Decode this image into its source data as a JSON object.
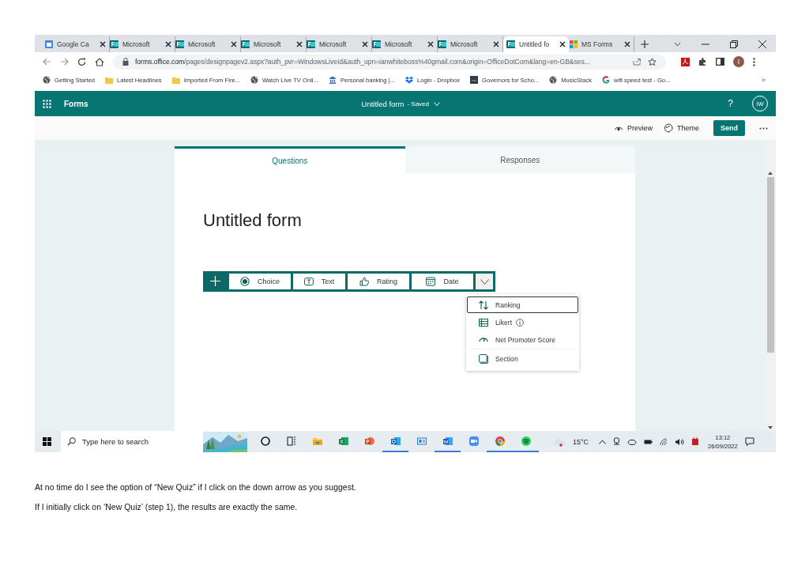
{
  "browser": {
    "tabs": [
      {
        "label": "Google Ca",
        "kind": "calendar",
        "selected": false
      },
      {
        "label": "Microsoft",
        "kind": "forms",
        "selected": false
      },
      {
        "label": "Microsoft",
        "kind": "forms",
        "selected": false
      },
      {
        "label": "Microsoft",
        "kind": "forms",
        "selected": false
      },
      {
        "label": "Microsoft",
        "kind": "forms",
        "selected": false
      },
      {
        "label": "Microsoft",
        "kind": "forms",
        "selected": false
      },
      {
        "label": "Microsoft",
        "kind": "forms",
        "selected": false
      },
      {
        "label": "Untitled fo",
        "kind": "forms",
        "selected": true
      },
      {
        "label": "MS Forms",
        "kind": "windows",
        "selected": false
      }
    ],
    "address_host": "forms.office.com",
    "address_path": "/pages/designpagev2.aspx?auth_pvr=WindowsLiveId&auth_upn=ianwhiteboss%40gmail.com&origin=OfficeDotCom&lang=en-GB&ses...",
    "bookmarks": [
      {
        "label": "Getting Started",
        "kind": "globe"
      },
      {
        "label": "Latest Headlines",
        "kind": "folder"
      },
      {
        "label": "Imported From Fire...",
        "kind": "folder"
      },
      {
        "label": "Watch Live TV Onli...",
        "kind": "globe"
      },
      {
        "label": "Personal banking |...",
        "kind": "bank"
      },
      {
        "label": "Login - Dropbox",
        "kind": "dropbox"
      },
      {
        "label": "Governors for Scho...",
        "kind": "square"
      },
      {
        "label": "MusicStack",
        "kind": "globe"
      },
      {
        "label": "wifi speed test - Go...",
        "kind": "google"
      }
    ],
    "bookmarks_more": "»"
  },
  "forms_header": {
    "app_name": "Forms",
    "form_title": "Untitled form",
    "save_state": "- Saved",
    "help": "?",
    "avatar": "IW"
  },
  "command_bar": [
    {
      "label": "Preview",
      "kind": "preview"
    },
    {
      "label": "Theme",
      "kind": "theme"
    },
    {
      "label": "Send",
      "kind": "primary"
    }
  ],
  "editor_tabs": [
    {
      "label": "Questions",
      "selected": true
    },
    {
      "label": "Responses",
      "selected": false
    }
  ],
  "form_title": "Untitled form",
  "question_types": [
    {
      "label": "Choice",
      "kind": "radio"
    },
    {
      "label": "Text",
      "kind": "text"
    },
    {
      "label": "Rating",
      "kind": "thumb"
    },
    {
      "label": "Date",
      "kind": "calendar"
    }
  ],
  "more_types": [
    {
      "label": "Ranking",
      "kind": "ranking",
      "info": false,
      "selected": true
    },
    {
      "label": "Likert",
      "kind": "likert",
      "info": true,
      "selected": false
    },
    {
      "label": "Net Promoter Score",
      "kind": "nps",
      "info": false,
      "selected": false
    },
    {
      "label": "Section",
      "kind": "section",
      "info": false,
      "selected": false
    }
  ],
  "taskbar": {
    "search_placeholder": "Type here to search",
    "apps": [
      {
        "kind": "cortana",
        "running": false
      },
      {
        "kind": "taskview",
        "running": false
      },
      {
        "kind": "explorer",
        "running": false
      },
      {
        "kind": "excel",
        "running": false
      },
      {
        "kind": "powerpoint",
        "running": false
      },
      {
        "kind": "outlook",
        "running": true
      },
      {
        "kind": "app",
        "running": false
      },
      {
        "kind": "word",
        "running": true
      },
      {
        "kind": "zoom",
        "running": false
      },
      {
        "kind": "chrome",
        "running": true
      },
      {
        "kind": "spotify",
        "running": true
      }
    ],
    "weather": "15°C",
    "time": "13:12",
    "date": "26/09/2022"
  },
  "document": {
    "paragraphs": [
      "At no time do I see the option of “New Quiz” if I click on the down arrow as you suggest.",
      "If I initially click on ‘New Quiz’ (step 1), the results are exactly the same."
    ]
  }
}
